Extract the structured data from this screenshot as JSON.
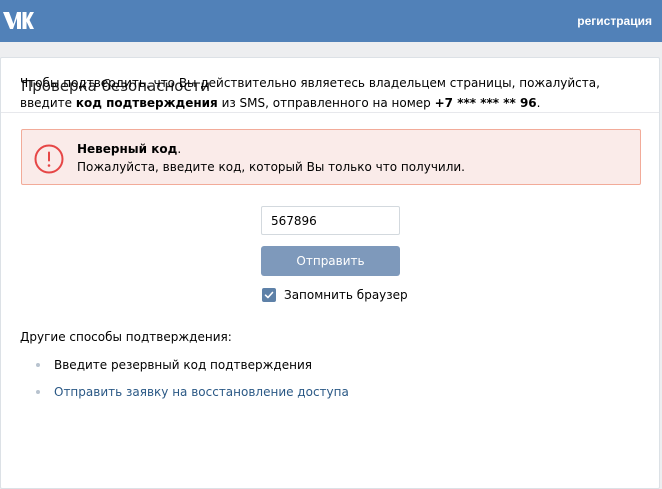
{
  "header": {
    "logo_icon": "vk-logo-icon",
    "register_label": "регистрация",
    "background_color": "#5181b8"
  },
  "card": {
    "title": "Проверка безопасности",
    "intro": {
      "part1": "Чтобы подтвердить, что Вы действительно являетесь владельцем страницы, пожалуйста, введите ",
      "bold1": "код подтверждения",
      "part2": " из SMS, отправленного на номер ",
      "bold2": "+7 *** *** ** 96",
      "part3": "."
    },
    "error": {
      "icon": "exclamation-circle-icon",
      "title": "Неверный код",
      "title_suffix": ".",
      "message": "Пожалуйста, введите код, который Вы только что получили.",
      "accent_color": "#e64646"
    },
    "code_input": {
      "value": "567896"
    },
    "submit_label": "Отправить",
    "remember": {
      "label": "Запомнить браузер",
      "checked": true
    },
    "other_methods": {
      "title": "Другие способы подтверждения:",
      "options": [
        {
          "label": "Введите резервный код подтверждения"
        },
        {
          "label": "Отправить заявку на восстановление доступа"
        }
      ]
    }
  }
}
